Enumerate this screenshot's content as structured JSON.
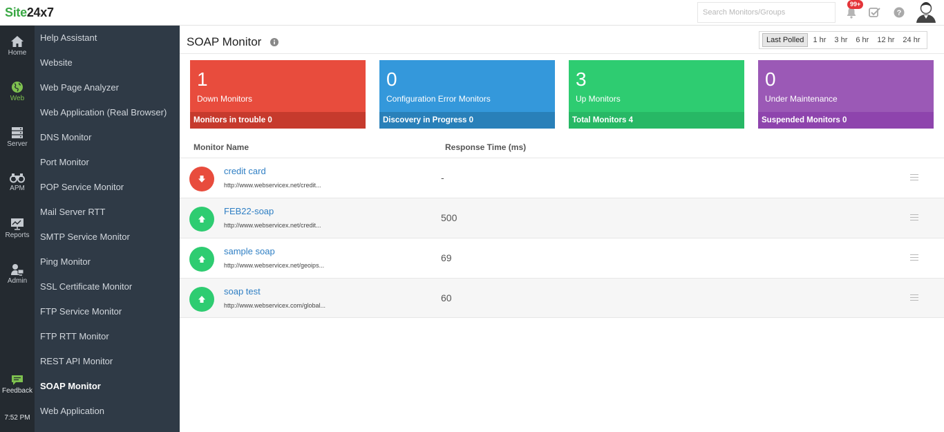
{
  "app": {
    "logo_part1": "Site",
    "logo_part2": "24x7",
    "search_placeholder": "Search Monitors/Groups",
    "notifications_badge": "99+"
  },
  "rail": {
    "items": [
      {
        "label": "Home",
        "icon": "home-icon"
      },
      {
        "label": "Web",
        "icon": "globe-icon",
        "active": true
      },
      {
        "label": "Server",
        "icon": "server-icon"
      },
      {
        "label": "APM",
        "icon": "binoculars-icon"
      },
      {
        "label": "Reports",
        "icon": "chart-icon"
      },
      {
        "label": "Admin",
        "icon": "admin-icon"
      },
      {
        "label": "Feedback",
        "icon": "feedback-icon"
      }
    ],
    "time": "7:52 PM"
  },
  "submenu": {
    "items": [
      "Help Assistant",
      "Website",
      "Web Page Analyzer",
      "Web Application (Real Browser)",
      "DNS Monitor",
      "Port Monitor",
      "POP Service Monitor",
      "Mail Server RTT",
      "SMTP Service Monitor",
      "Ping Monitor",
      "SSL Certificate Monitor",
      "FTP Service Monitor",
      "FTP RTT Monitor",
      "REST API Monitor",
      "SOAP Monitor",
      "Web Application"
    ],
    "active": "SOAP Monitor"
  },
  "main": {
    "title": "SOAP Monitor",
    "ranges": [
      "Last Polled",
      "1 hr",
      "3 hr",
      "6 hr",
      "12 hr",
      "24 hr"
    ],
    "active_range": "Last Polled",
    "cards": [
      {
        "count": "1",
        "label": "Down Monitors",
        "footer_label": "Monitors in trouble",
        "footer_value": "0",
        "color": "#e84c3d",
        "footer_color": "#c63a2d"
      },
      {
        "count": "0",
        "label": "Configuration Error Monitors",
        "footer_label": "Discovery in Progress",
        "footer_value": "0",
        "color": "#3498db",
        "footer_color": "#2980b9"
      },
      {
        "count": "3",
        "label": "Up Monitors",
        "footer_label": "Total Monitors",
        "footer_value": "4",
        "color": "#2ecc71",
        "footer_color": "#27b865"
      },
      {
        "count": "0",
        "label": "Under Maintenance",
        "footer_label": "Suspended Monitors",
        "footer_value": "0",
        "color": "#9b59b6",
        "footer_color": "#8e44ad"
      }
    ],
    "table": {
      "headers": [
        "Monitor Name",
        "Response Time (ms)"
      ],
      "rows": [
        {
          "name": "credit card",
          "url": "http://www.webservicex.net/credit...",
          "response": "-",
          "status": "down"
        },
        {
          "name": "FEB22-soap",
          "url": "http://www.webservicex.net/credit...",
          "response": "500",
          "status": "up"
        },
        {
          "name": "sample soap",
          "url": "http://www.webservicex.net/geoips...",
          "response": "69",
          "status": "up"
        },
        {
          "name": "soap test",
          "url": "http://www.webservicex.com/global...",
          "response": "60",
          "status": "up"
        }
      ]
    }
  },
  "colors": {
    "down": "#e84c3d",
    "up": "#2ecc71",
    "link": "#2f7fc4"
  }
}
